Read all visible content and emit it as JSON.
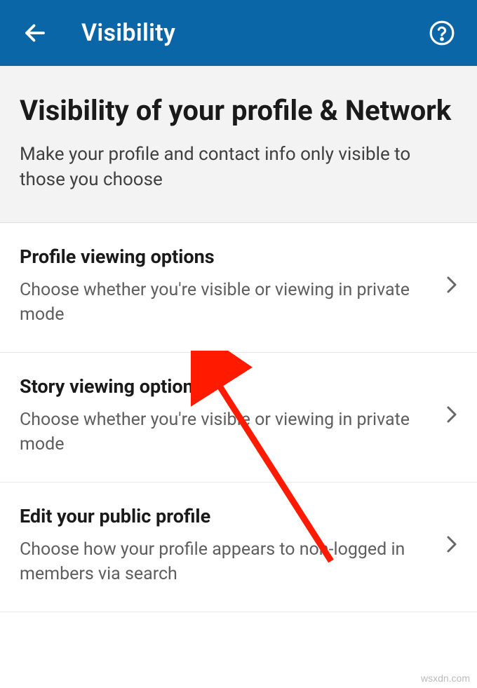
{
  "header": {
    "title": "Visibility"
  },
  "section": {
    "title": "Visibility of your profile & Network",
    "subtitle": "Make your profile and contact info only visible to those you choose"
  },
  "settings": [
    {
      "title": "Profile viewing options",
      "desc": "Choose whether you're visible or viewing in private mode"
    },
    {
      "title": "Story viewing options",
      "desc": "Choose whether you're visible or viewing in private mode"
    },
    {
      "title": "Edit your public profile",
      "desc": "Choose how your profile appears to non-logged in members via search"
    }
  ],
  "watermark": "wsxdn.com"
}
